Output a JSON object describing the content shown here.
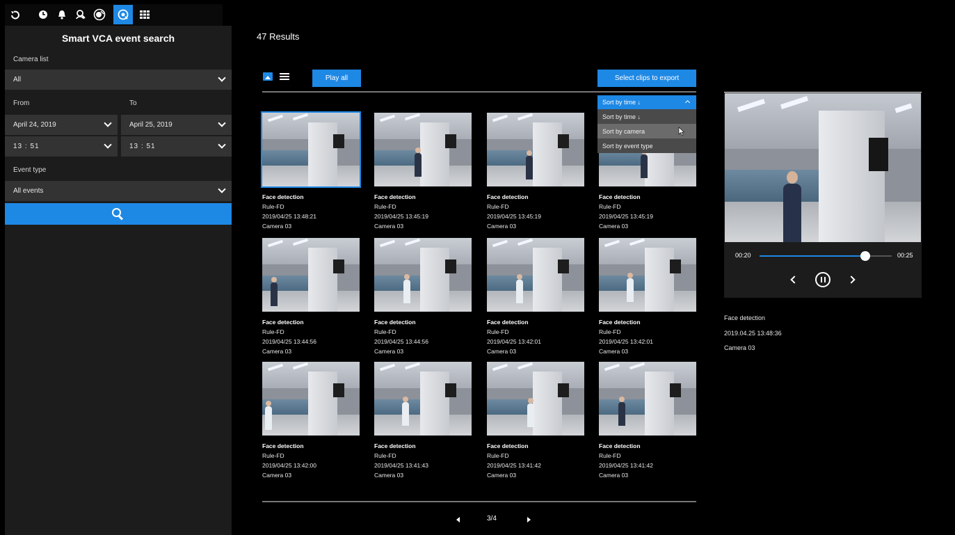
{
  "topbar": {
    "icons": [
      "back-icon",
      "clock-icon",
      "bell-icon",
      "face-search-icon",
      "vca-icon",
      "smart-search-icon",
      "grid-icon"
    ],
    "active_icon": "smart-search-icon"
  },
  "sidebar": {
    "title": "Smart VCA event search",
    "camera_list_label": "Camera list",
    "camera_list_value": "All",
    "from_label": "From",
    "to_label": "To",
    "from_date": "April 24, 2019",
    "to_date": "April 25, 2019",
    "from_time": "13 : 51",
    "to_time": "13 : 51",
    "event_type_label": "Event type",
    "event_type_value": "All events",
    "search_icon": "search-icon"
  },
  "main": {
    "results_title": "47 Results",
    "play_all_label": "Play all",
    "export_label": "Select clips to export",
    "sort": {
      "selected": "Sort by time ↓",
      "options": [
        "Sort by time ↓",
        "Sort by camera",
        "Sort by event type"
      ],
      "hovered": "Sort by camera"
    },
    "cards": [
      {
        "title": "Face detection",
        "rule": "Rule-FD",
        "time": "2019/04/25 13:48:21",
        "camera": "Camera 03"
      },
      {
        "title": "Face detection",
        "rule": "Rule-FD",
        "time": "2019/04/25 13:45:19",
        "camera": "Camera 03"
      },
      {
        "title": "Face detection",
        "rule": "Rule-FD",
        "time": "2019/04/25 13:45:19",
        "camera": "Camera 03"
      },
      {
        "title": "Face detection",
        "rule": "Rule-FD",
        "time": "2019/04/25 13:45:19",
        "camera": "Camera 03"
      },
      {
        "title": "Face detection",
        "rule": "Rule-FD",
        "time": "2019/04/25 13:44:56",
        "camera": "Camera 03"
      },
      {
        "title": "Face detection",
        "rule": "Rule-FD",
        "time": "2019/04/25 13:44:56",
        "camera": "Camera 03"
      },
      {
        "title": "Face detection",
        "rule": "Rule-FD",
        "time": "2019/04/25 13:42:01",
        "camera": "Camera 03"
      },
      {
        "title": "Face detection",
        "rule": "Rule-FD",
        "time": "2019/04/25 13:42:01",
        "camera": "Camera 03"
      },
      {
        "title": "Face detection",
        "rule": "Rule-FD",
        "time": "2019/04/25 13:42:00",
        "camera": "Camera 03"
      },
      {
        "title": "Face detection",
        "rule": "Rule-FD",
        "time": "2019/04/25 13:41:43",
        "camera": "Camera 03"
      },
      {
        "title": "Face detection",
        "rule": "Rule-FD",
        "time": "2019/04/25 13:41:42",
        "camera": "Camera 03"
      },
      {
        "title": "Face detection",
        "rule": "Rule-FD",
        "time": "2019/04/25 13:41:42",
        "camera": "Camera 03"
      }
    ],
    "pagination": {
      "label": "3/4"
    }
  },
  "preview": {
    "time_start": "00:20",
    "time_end": "00:25",
    "progress": 0.8,
    "event": "Face detection",
    "timestamp": "2019.04.25 13:48:36",
    "camera": "Camera 03"
  },
  "colors": {
    "accent": "#1e88e5",
    "sidebar_bg": "#1c1c1c",
    "field_bg": "#333333"
  }
}
